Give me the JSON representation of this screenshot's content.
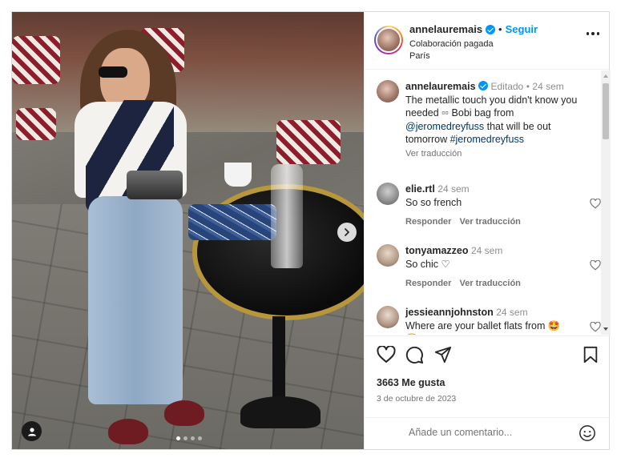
{
  "post": {
    "username": "annelauremais",
    "follow_label": "Seguir",
    "dot": "•",
    "subtitle": "Colaboración pagada",
    "location": "París",
    "more_icon": "more-horizontal-icon"
  },
  "caption": {
    "username": "annelauremais",
    "edited": "Editado",
    "dot": "•",
    "time": "24 sem",
    "text_before": "The metallic touch you didn't know you needed ",
    "symbols": "▫▫",
    "text_middle": " Bobi bag from ",
    "mention": "@jeromedreyfuss",
    "text_after": " that will be out tomorrow ",
    "hashtag": "#jeromedreyfuss",
    "translate": "Ver traducción"
  },
  "comments": [
    {
      "username": "elie.rtl",
      "time": "24 sem",
      "text": "So so french",
      "reply": "Responder",
      "translate": "Ver traducción"
    },
    {
      "username": "tonyamazzeo",
      "time": "24 sem",
      "text": "So chic ♡",
      "reply": "Responder",
      "translate": "Ver traducción"
    },
    {
      "username": "jessieannjohnston",
      "time": "24 sem",
      "text": "Where are your ballet flats from 🤩",
      "extra": "🤩"
    }
  ],
  "footer": {
    "likes": "3663 Me gusta",
    "date": "3 de octubre de 2023",
    "comment_placeholder": "Añade un comentario...",
    "icons": [
      "heart-icon",
      "comment-icon",
      "share-icon",
      "bookmark-icon",
      "emoji-icon"
    ]
  },
  "carousel": {
    "slides": 4,
    "active": 0
  },
  "colors": {
    "accent": "#0095f6",
    "link": "#00376b",
    "muted": "#737373",
    "border": "#dbdbdb"
  }
}
